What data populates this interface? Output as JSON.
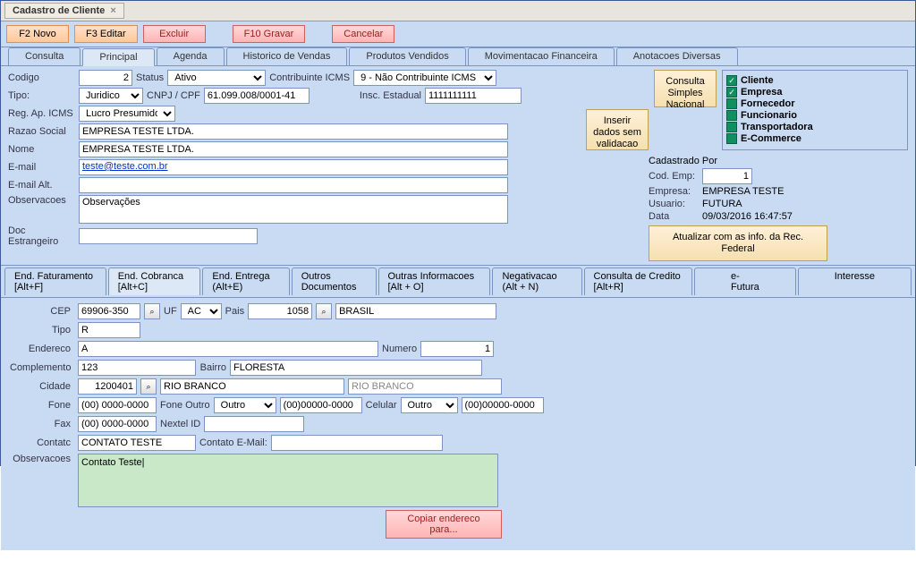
{
  "window": {
    "title": "Cadastro de Cliente"
  },
  "toolbar": {
    "novo": "F2 Novo",
    "editar": "F3 Editar",
    "excluir": "Excluir",
    "gravar": "F10 Gravar",
    "cancelar": "Cancelar"
  },
  "tabs": {
    "consulta": "Consulta",
    "principal": "Principal",
    "agenda": "Agenda",
    "historico": "Historico de Vendas",
    "produtos": "Produtos Vendidos",
    "movfin": "Movimentacao Financeira",
    "anotacoes": "Anotacoes Diversas"
  },
  "principal": {
    "labels": {
      "codigo": "Codigo",
      "status": "Status",
      "contribuinte": "Contribuinte ICMS",
      "tipo": "Tipo:",
      "cnpj": "CNPJ / CPF",
      "insc_est": "Insc. Estadual",
      "reg_ap": "Reg. Ap. ICMS",
      "razao": "Razao Social",
      "nome": "Nome",
      "email": "E-mail",
      "email_alt": "E-mail Alt.",
      "observacoes": "Observacoes",
      "doc_estr": "Doc Estrangeiro"
    },
    "codigo": "2",
    "status": "Ativo",
    "contribuinte": "9 - Não Contribuinte ICMS",
    "tipo": "Juridico",
    "cnpj": "61.099.008/0001-41",
    "insc_est": "1111111111",
    "reg_ap": "Lucro Presumido/R",
    "razao": "EMPRESA TESTE LTDA.",
    "nome": "EMPRESA TESTE LTDA.",
    "email": "teste@teste.com.br",
    "email_alt": "",
    "observacoes": "Observações",
    "doc_estr": "",
    "btn_inserir": "Inserir dados sem validacao",
    "btn_consulta_simples": "Consulta Simples Nacional",
    "types": {
      "cliente": "Cliente",
      "empresa": "Empresa",
      "fornecedor": "Fornecedor",
      "funcionario": "Funcionario",
      "transportadora": "Transportadora",
      "ecommerce": "E-Commerce"
    },
    "cadastrado": {
      "title": "Cadastrado Por",
      "cod_emp_lbl": "Cod. Emp:",
      "cod_emp": "1",
      "empresa_lbl": "Empresa:",
      "empresa": "EMPRESA TESTE",
      "usuario_lbl": "Usuario:",
      "usuario": "FUTURA",
      "data_lbl": "Data",
      "data": "09/03/2016 16:47:57"
    },
    "btn_atualizar": "Atualizar com as info. da Rec. Federal"
  },
  "subtabs": {
    "faturamento": "End. Faturamento [Alt+F]",
    "cobranca": "End. Cobranca [Alt+C]",
    "entrega": "End. Entrega (Alt+E)",
    "outros_doc": "Outros Documentos",
    "outras_info": "Outras Informacoes [Alt + O]",
    "negativacao": "Negativacao (Alt + N)",
    "consulta_cred": "Consulta de Credito [Alt+R]",
    "efutura": "e-Futura",
    "interesse": "Interesse"
  },
  "endereco": {
    "labels": {
      "cep": "CEP",
      "uf": "UF",
      "pais": "Pais",
      "tipo": "Tipo",
      "endereco": "Endereco",
      "numero": "Numero",
      "complemento": "Complemento",
      "bairro": "Bairro",
      "cidade": "Cidade",
      "fone": "Fone",
      "fone_outro": "Fone Outro",
      "celular": "Celular",
      "fax": "Fax",
      "nextel": "Nextel ID",
      "contato": "Contatc",
      "contato_email": "Contato E-Mail:",
      "observacoes": "Observacoes"
    },
    "cep": "69906-350",
    "uf": "AC",
    "pais_cod": "1058",
    "pais_nome": "BRASIL",
    "tipo": "R",
    "endereco": "A",
    "numero": "1",
    "complemento": "123",
    "bairro": "FLORESTA",
    "cidade_cod": "1200401",
    "cidade_nome": "RIO BRANCO",
    "cidade_nome2": "RIO BRANCO",
    "fone": "(00) 0000-0000",
    "fone_outro_tipo": "Outro",
    "fone_outro": "(00)00000-0000",
    "celular_tipo": "Outro",
    "celular": "(00)00000-0000",
    "fax": "(00) 0000-0000",
    "nextel": "",
    "contato": "CONTATO TESTE",
    "contato_email": "",
    "observacoes": "Contato Teste|",
    "btn_copiar": "Copiar endereco para..."
  }
}
